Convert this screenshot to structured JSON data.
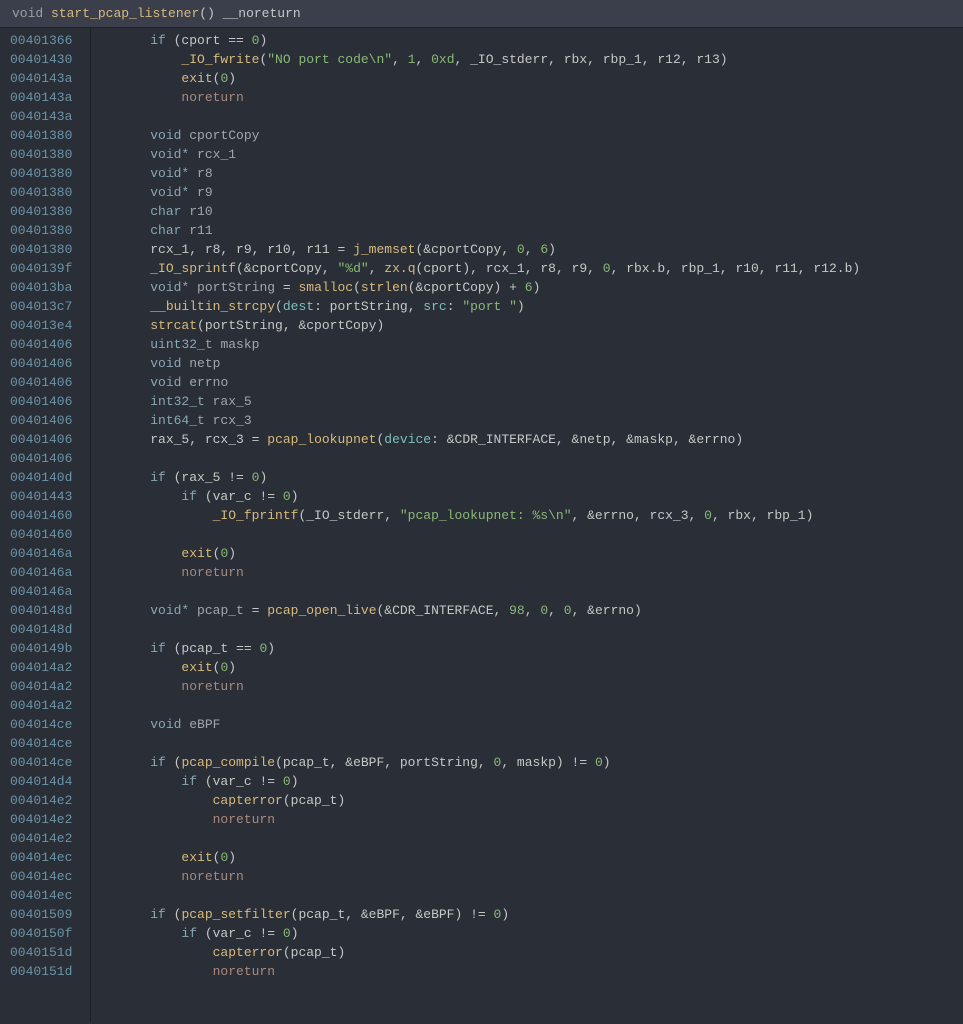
{
  "header": {
    "kw_void": "void",
    "fn_name": "start_pcap_listener",
    "parens": "()",
    "attr": " __noreturn"
  },
  "addresses": [
    "00401366",
    "00401430",
    "0040143a",
    "0040143a",
    "0040143a",
    "00401380",
    "00401380",
    "00401380",
    "00401380",
    "00401380",
    "00401380",
    "00401380",
    "0040139f",
    "004013ba",
    "004013c7",
    "004013e4",
    "00401406",
    "00401406",
    "00401406",
    "00401406",
    "00401406",
    "00401406",
    "00401406",
    "0040140d",
    "00401443",
    "00401460",
    "00401460",
    "0040146a",
    "0040146a",
    "0040146a",
    "0040148d",
    "0040148d",
    "0040149b",
    "004014a2",
    "004014a2",
    "004014a2",
    "004014ce",
    "004014ce",
    "004014ce",
    "004014d4",
    "004014e2",
    "004014e2",
    "004014e2",
    "004014ec",
    "004014ec",
    "004014ec",
    "00401509",
    "0040150f",
    "0040151d",
    "0040151d"
  ],
  "code": {
    "l0": {
      "indent": 1,
      "t": [
        {
          "c": "kw",
          "s": "if"
        },
        {
          "c": "punct",
          "s": " (cport "
        },
        {
          "c": "op",
          "s": "=="
        },
        {
          "c": "punct",
          "s": " "
        },
        {
          "c": "num",
          "s": "0"
        },
        {
          "c": "punct",
          "s": ")"
        }
      ]
    },
    "l1": {
      "indent": 2,
      "t": [
        {
          "c": "fn",
          "s": "_IO_fwrite"
        },
        {
          "c": "punct",
          "s": "("
        },
        {
          "c": "str",
          "s": "\"NO port code\\n\""
        },
        {
          "c": "punct",
          "s": ", "
        },
        {
          "c": "num",
          "s": "1"
        },
        {
          "c": "punct",
          "s": ", "
        },
        {
          "c": "num",
          "s": "0xd"
        },
        {
          "c": "punct",
          "s": ", "
        },
        {
          "c": "var",
          "s": "_IO_stderr"
        },
        {
          "c": "punct",
          "s": ", rbx, rbp_1, r12, r13)"
        }
      ]
    },
    "l2": {
      "indent": 2,
      "t": [
        {
          "c": "fn",
          "s": "exit"
        },
        {
          "c": "punct",
          "s": "("
        },
        {
          "c": "num",
          "s": "0"
        },
        {
          "c": "punct",
          "s": ")"
        }
      ]
    },
    "l3": {
      "indent": 2,
      "t": [
        {
          "c": "noret",
          "s": "noreturn"
        }
      ]
    },
    "l4": {
      "indent": 0,
      "t": [
        {
          "c": "punct",
          "s": ""
        }
      ]
    },
    "l5": {
      "indent": 1,
      "t": [
        {
          "c": "type",
          "s": "void"
        },
        {
          "c": "varname",
          "s": " cportCopy"
        }
      ]
    },
    "l6": {
      "indent": 1,
      "t": [
        {
          "c": "type",
          "s": "void*"
        },
        {
          "c": "varname",
          "s": " rcx_1"
        }
      ]
    },
    "l7": {
      "indent": 1,
      "t": [
        {
          "c": "type",
          "s": "void*"
        },
        {
          "c": "varname",
          "s": " r8"
        }
      ]
    },
    "l8": {
      "indent": 1,
      "t": [
        {
          "c": "type",
          "s": "void*"
        },
        {
          "c": "varname",
          "s": " r9"
        }
      ]
    },
    "l9": {
      "indent": 1,
      "t": [
        {
          "c": "type",
          "s": "char"
        },
        {
          "c": "varname",
          "s": " r10"
        }
      ]
    },
    "l10": {
      "indent": 1,
      "t": [
        {
          "c": "type",
          "s": "char"
        },
        {
          "c": "varname",
          "s": " r11"
        }
      ]
    },
    "l11": {
      "indent": 1,
      "t": [
        {
          "c": "var",
          "s": "rcx_1, r8, r9, r10, r11 "
        },
        {
          "c": "op",
          "s": "="
        },
        {
          "c": "punct",
          "s": " "
        },
        {
          "c": "fn",
          "s": "j_memset"
        },
        {
          "c": "punct",
          "s": "(&cportCopy, "
        },
        {
          "c": "num",
          "s": "0"
        },
        {
          "c": "punct",
          "s": ", "
        },
        {
          "c": "num",
          "s": "6"
        },
        {
          "c": "punct",
          "s": ")"
        }
      ]
    },
    "l12": {
      "indent": 1,
      "t": [
        {
          "c": "fn",
          "s": "_IO_sprintf"
        },
        {
          "c": "punct",
          "s": "(&cportCopy, "
        },
        {
          "c": "str",
          "s": "\"%d\""
        },
        {
          "c": "punct",
          "s": ", "
        },
        {
          "c": "fn",
          "s": "zx.q"
        },
        {
          "c": "punct",
          "s": "(cport), rcx_1, r8, r9, "
        },
        {
          "c": "num",
          "s": "0"
        },
        {
          "c": "punct",
          "s": ", rbx.b, rbp_1, r10, r11, r12.b)"
        }
      ]
    },
    "l13": {
      "indent": 1,
      "t": [
        {
          "c": "type",
          "s": "void*"
        },
        {
          "c": "varname",
          "s": " portString "
        },
        {
          "c": "op",
          "s": "="
        },
        {
          "c": "punct",
          "s": " "
        },
        {
          "c": "fn",
          "s": "smalloc"
        },
        {
          "c": "punct",
          "s": "("
        },
        {
          "c": "fn",
          "s": "strlen"
        },
        {
          "c": "punct",
          "s": "(&cportCopy) "
        },
        {
          "c": "op",
          "s": "+"
        },
        {
          "c": "punct",
          "s": " "
        },
        {
          "c": "num",
          "s": "6"
        },
        {
          "c": "punct",
          "s": ")"
        }
      ]
    },
    "l14": {
      "indent": 1,
      "t": [
        {
          "c": "fn",
          "s": "__builtin_strcpy"
        },
        {
          "c": "punct",
          "s": "("
        },
        {
          "c": "param",
          "s": "dest"
        },
        {
          "c": "punct",
          "s": ": portString, "
        },
        {
          "c": "param",
          "s": "src"
        },
        {
          "c": "punct",
          "s": ": "
        },
        {
          "c": "str",
          "s": "\"port \""
        },
        {
          "c": "punct",
          "s": ")"
        }
      ]
    },
    "l15": {
      "indent": 1,
      "t": [
        {
          "c": "fn",
          "s": "strcat"
        },
        {
          "c": "punct",
          "s": "(portString, &cportCopy)"
        }
      ]
    },
    "l16": {
      "indent": 1,
      "t": [
        {
          "c": "type",
          "s": "uint32_t"
        },
        {
          "c": "varname",
          "s": " maskp"
        }
      ]
    },
    "l17": {
      "indent": 1,
      "t": [
        {
          "c": "type",
          "s": "void"
        },
        {
          "c": "varname",
          "s": " netp"
        }
      ]
    },
    "l18": {
      "indent": 1,
      "t": [
        {
          "c": "type",
          "s": "void"
        },
        {
          "c": "varname",
          "s": " errno"
        }
      ]
    },
    "l19": {
      "indent": 1,
      "t": [
        {
          "c": "type",
          "s": "int32_t"
        },
        {
          "c": "varname",
          "s": " rax_5"
        }
      ]
    },
    "l20": {
      "indent": 1,
      "t": [
        {
          "c": "type",
          "s": "int64_t"
        },
        {
          "c": "varname",
          "s": " rcx_3"
        }
      ]
    },
    "l21": {
      "indent": 1,
      "t": [
        {
          "c": "var",
          "s": "rax_5, rcx_3 "
        },
        {
          "c": "op",
          "s": "="
        },
        {
          "c": "punct",
          "s": " "
        },
        {
          "c": "fn",
          "s": "pcap_lookupnet"
        },
        {
          "c": "punct",
          "s": "("
        },
        {
          "c": "param",
          "s": "device"
        },
        {
          "c": "punct",
          "s": ": &CDR_INTERFACE, &netp, &maskp, &errno)"
        }
      ]
    },
    "l22": {
      "indent": 0,
      "t": [
        {
          "c": "punct",
          "s": ""
        }
      ]
    },
    "l23": {
      "indent": 1,
      "t": [
        {
          "c": "kw",
          "s": "if"
        },
        {
          "c": "punct",
          "s": " (rax_5 "
        },
        {
          "c": "op",
          "s": "!="
        },
        {
          "c": "punct",
          "s": " "
        },
        {
          "c": "num",
          "s": "0"
        },
        {
          "c": "punct",
          "s": ")"
        }
      ]
    },
    "l24": {
      "indent": 2,
      "t": [
        {
          "c": "kw",
          "s": "if"
        },
        {
          "c": "punct",
          "s": " (var_c "
        },
        {
          "c": "op",
          "s": "!="
        },
        {
          "c": "punct",
          "s": " "
        },
        {
          "c": "num",
          "s": "0"
        },
        {
          "c": "punct",
          "s": ")"
        }
      ]
    },
    "l25": {
      "indent": 3,
      "t": [
        {
          "c": "fn",
          "s": "_IO_fprintf"
        },
        {
          "c": "punct",
          "s": "(_IO_stderr, "
        },
        {
          "c": "str",
          "s": "\"pcap_lookupnet: %s\\n\""
        },
        {
          "c": "punct",
          "s": ", &errno, rcx_3, "
        },
        {
          "c": "num",
          "s": "0"
        },
        {
          "c": "punct",
          "s": ", rbx, rbp_1)"
        }
      ]
    },
    "l26": {
      "indent": 0,
      "t": [
        {
          "c": "punct",
          "s": ""
        }
      ]
    },
    "l27": {
      "indent": 2,
      "t": [
        {
          "c": "fn",
          "s": "exit"
        },
        {
          "c": "punct",
          "s": "("
        },
        {
          "c": "num",
          "s": "0"
        },
        {
          "c": "punct",
          "s": ")"
        }
      ]
    },
    "l28": {
      "indent": 2,
      "t": [
        {
          "c": "noret",
          "s": "noreturn"
        }
      ]
    },
    "l29": {
      "indent": 0,
      "t": [
        {
          "c": "punct",
          "s": ""
        }
      ]
    },
    "l30": {
      "indent": 1,
      "t": [
        {
          "c": "type",
          "s": "void*"
        },
        {
          "c": "varname",
          "s": " pcap_t "
        },
        {
          "c": "op",
          "s": "="
        },
        {
          "c": "punct",
          "s": " "
        },
        {
          "c": "fn",
          "s": "pcap_open_live"
        },
        {
          "c": "punct",
          "s": "(&CDR_INTERFACE, "
        },
        {
          "c": "num",
          "s": "98"
        },
        {
          "c": "punct",
          "s": ", "
        },
        {
          "c": "num",
          "s": "0"
        },
        {
          "c": "punct",
          "s": ", "
        },
        {
          "c": "num",
          "s": "0"
        },
        {
          "c": "punct",
          "s": ", &errno)"
        }
      ]
    },
    "l31": {
      "indent": 0,
      "t": [
        {
          "c": "punct",
          "s": ""
        }
      ]
    },
    "l32": {
      "indent": 1,
      "t": [
        {
          "c": "kw",
          "s": "if"
        },
        {
          "c": "punct",
          "s": " (pcap_t "
        },
        {
          "c": "op",
          "s": "=="
        },
        {
          "c": "punct",
          "s": " "
        },
        {
          "c": "num",
          "s": "0"
        },
        {
          "c": "punct",
          "s": ")"
        }
      ]
    },
    "l33": {
      "indent": 2,
      "t": [
        {
          "c": "fn",
          "s": "exit"
        },
        {
          "c": "punct",
          "s": "("
        },
        {
          "c": "num",
          "s": "0"
        },
        {
          "c": "punct",
          "s": ")"
        }
      ]
    },
    "l34": {
      "indent": 2,
      "t": [
        {
          "c": "noret",
          "s": "noreturn"
        }
      ]
    },
    "l35": {
      "indent": 0,
      "t": [
        {
          "c": "punct",
          "s": ""
        }
      ]
    },
    "l36": {
      "indent": 1,
      "t": [
        {
          "c": "type",
          "s": "void"
        },
        {
          "c": "varname",
          "s": " eBPF"
        }
      ]
    },
    "l37": {
      "indent": 0,
      "t": [
        {
          "c": "punct",
          "s": ""
        }
      ]
    },
    "l38": {
      "indent": 1,
      "t": [
        {
          "c": "kw",
          "s": "if"
        },
        {
          "c": "punct",
          "s": " ("
        },
        {
          "c": "fn",
          "s": "pcap_compile"
        },
        {
          "c": "punct",
          "s": "(pcap_t, &eBPF, portString, "
        },
        {
          "c": "num",
          "s": "0"
        },
        {
          "c": "punct",
          "s": ", maskp) "
        },
        {
          "c": "op",
          "s": "!="
        },
        {
          "c": "punct",
          "s": " "
        },
        {
          "c": "num",
          "s": "0"
        },
        {
          "c": "punct",
          "s": ")"
        }
      ]
    },
    "l39": {
      "indent": 2,
      "t": [
        {
          "c": "kw",
          "s": "if"
        },
        {
          "c": "punct",
          "s": " (var_c "
        },
        {
          "c": "op",
          "s": "!="
        },
        {
          "c": "punct",
          "s": " "
        },
        {
          "c": "num",
          "s": "0"
        },
        {
          "c": "punct",
          "s": ")"
        }
      ]
    },
    "l40": {
      "indent": 3,
      "t": [
        {
          "c": "fn",
          "s": "capterror"
        },
        {
          "c": "punct",
          "s": "(pcap_t)"
        }
      ]
    },
    "l41": {
      "indent": 3,
      "t": [
        {
          "c": "noret",
          "s": "noreturn"
        }
      ]
    },
    "l42": {
      "indent": 0,
      "t": [
        {
          "c": "punct",
          "s": ""
        }
      ]
    },
    "l43": {
      "indent": 2,
      "t": [
        {
          "c": "fn",
          "s": "exit"
        },
        {
          "c": "punct",
          "s": "("
        },
        {
          "c": "num",
          "s": "0"
        },
        {
          "c": "punct",
          "s": ")"
        }
      ]
    },
    "l44": {
      "indent": 2,
      "t": [
        {
          "c": "noret",
          "s": "noreturn"
        }
      ]
    },
    "l45": {
      "indent": 0,
      "t": [
        {
          "c": "punct",
          "s": ""
        }
      ]
    },
    "l46": {
      "indent": 1,
      "t": [
        {
          "c": "kw",
          "s": "if"
        },
        {
          "c": "punct",
          "s": " ("
        },
        {
          "c": "fn",
          "s": "pcap_setfilter"
        },
        {
          "c": "punct",
          "s": "(pcap_t, &eBPF, &eBPF) "
        },
        {
          "c": "op",
          "s": "!="
        },
        {
          "c": "punct",
          "s": " "
        },
        {
          "c": "num",
          "s": "0"
        },
        {
          "c": "punct",
          "s": ")"
        }
      ]
    },
    "l47": {
      "indent": 2,
      "t": [
        {
          "c": "kw",
          "s": "if"
        },
        {
          "c": "punct",
          "s": " (var_c "
        },
        {
          "c": "op",
          "s": "!="
        },
        {
          "c": "punct",
          "s": " "
        },
        {
          "c": "num",
          "s": "0"
        },
        {
          "c": "punct",
          "s": ")"
        }
      ]
    },
    "l48": {
      "indent": 3,
      "t": [
        {
          "c": "fn",
          "s": "capterror"
        },
        {
          "c": "punct",
          "s": "(pcap_t)"
        }
      ]
    },
    "l49": {
      "indent": 3,
      "t": [
        {
          "c": "noret",
          "s": "noreturn"
        }
      ]
    }
  }
}
